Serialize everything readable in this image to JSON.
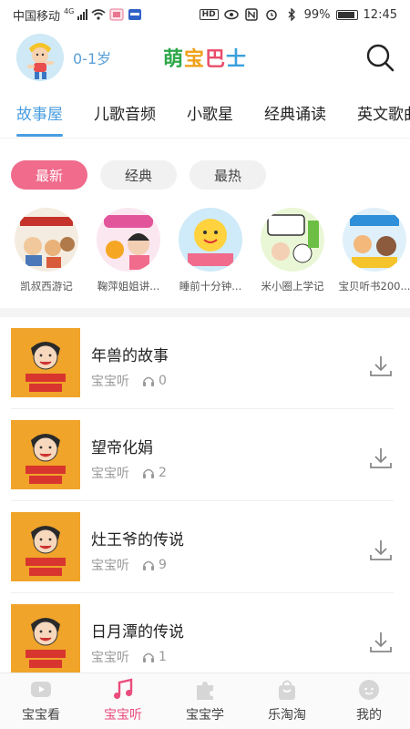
{
  "status_bar": {
    "carrier": "中国移动",
    "network": "4G",
    "battery": "99%",
    "time": "12:45",
    "hd": "HD"
  },
  "header": {
    "age": "0-1岁",
    "logo": [
      "萌",
      "宝",
      "巴",
      "士"
    ]
  },
  "tabs": [
    "故事屋",
    "儿歌音频",
    "小歌星",
    "经典诵读",
    "英文歌曲"
  ],
  "filters": [
    "最新",
    "经典",
    "最热"
  ],
  "albums": [
    {
      "name": "凯叔西游记"
    },
    {
      "name": "鞠萍姐姐讲..."
    },
    {
      "name": "睡前十分钟..."
    },
    {
      "name": "米小圈上学记"
    },
    {
      "name": "宝贝听书200..."
    }
  ],
  "stories": [
    {
      "title": "年兽的故事",
      "source": "宝宝听",
      "plays": "0"
    },
    {
      "title": "望帝化娟",
      "source": "宝宝听",
      "plays": "2"
    },
    {
      "title": "灶王爷的传说",
      "source": "宝宝听",
      "plays": "9"
    },
    {
      "title": "日月潭的传说",
      "source": "宝宝听",
      "plays": "1"
    }
  ],
  "bottom_nav": [
    "宝宝看",
    "宝宝听",
    "宝宝学",
    "乐淘淘",
    "我的"
  ],
  "colors": {
    "accent_blue": "#4a9de0",
    "accent_pink": "#f06b8c",
    "thumb_orange": "#f0a42a"
  }
}
